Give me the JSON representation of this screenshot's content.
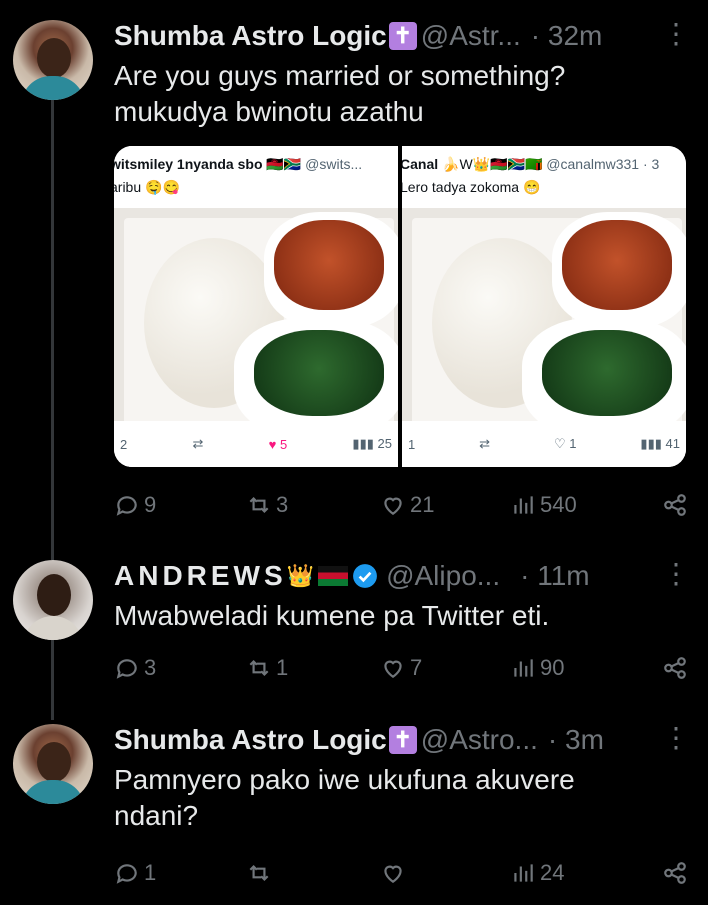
{
  "tweets": [
    {
      "name": "Shumba Astro Logic",
      "badge": "✝",
      "handle": "@Astr...",
      "time": "· 32m",
      "text_lines": [
        "Are you guys married or something?",
        "mukudya bwinotu azathu"
      ],
      "replies": "9",
      "reposts": "3",
      "likes": "21",
      "views": "540"
    },
    {
      "name": "ANDREWS",
      "name_emoji": "👑",
      "handle": "@Alipo...",
      "time": "· 11m",
      "text_lines": [
        "Mwabweladi kumene pa Twitter eti."
      ],
      "replies": "3",
      "reposts": "1",
      "likes": "7",
      "views": "90"
    },
    {
      "name": "Shumba Astro Logic",
      "badge": "✝",
      "handle": "@Astro...",
      "time": "· 3m",
      "text_lines": [
        "Pamnyero pako iwe ukufuna akuvere",
        "ndani?"
      ],
      "replies": "1",
      "reposts": "",
      "likes": "",
      "views": "24"
    }
  ],
  "media": {
    "left": {
      "name": "witsmiley 1nyanda sbo",
      "flags": "🇲🇼🇿🇦",
      "handle": "@swits...",
      "text": "aribu 🤤😋",
      "replies": "2",
      "likes": "5",
      "views": "25"
    },
    "right": {
      "name": "Canal",
      "flags": "🍌W👑🇲🇼🇿🇦🇿🇲",
      "handle": "@canalmw331 · 3",
      "text": "Lero tadya zokoma 😁",
      "replies": "1",
      "likes": "1",
      "views": "41"
    }
  },
  "icons": [
    "more-icon",
    "reply-icon",
    "repost-icon",
    "like-icon",
    "views-icon",
    "share-icon",
    "verified-icon"
  ],
  "colors": {
    "background": "#000000",
    "text": "#e7e9ea",
    "muted": "#71767b",
    "like_pink": "#f91880",
    "verified": "#1d9bf0"
  }
}
